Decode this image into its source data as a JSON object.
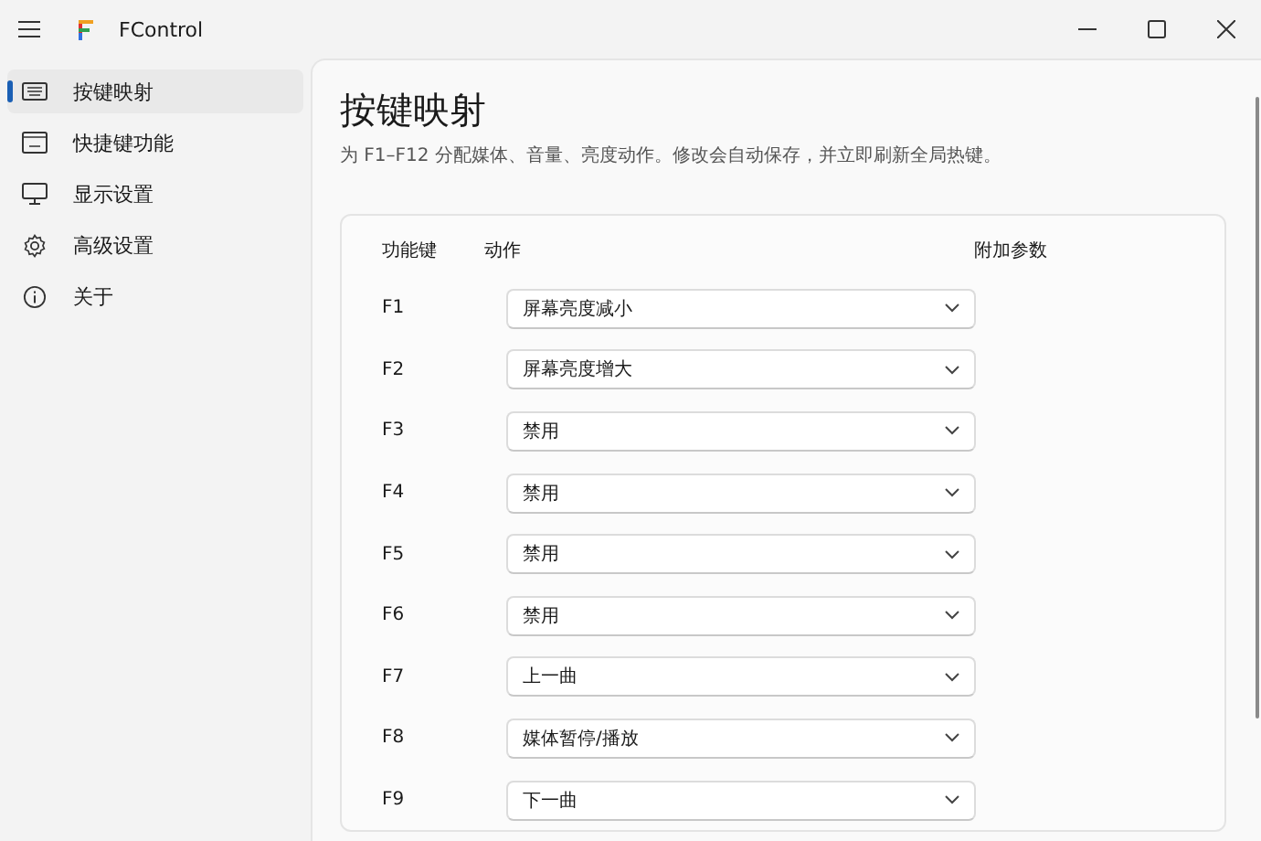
{
  "window": {
    "title": "FControl"
  },
  "sidebar": {
    "items": [
      {
        "label": "按键映射",
        "kind": "keyboard",
        "selected": true
      },
      {
        "label": "快捷键功能",
        "kind": "shortcut",
        "selected": false
      },
      {
        "label": "显示设置",
        "kind": "monitor",
        "selected": false
      },
      {
        "label": "高级设置",
        "kind": "gear",
        "selected": false
      },
      {
        "label": "关于",
        "kind": "info",
        "selected": false
      }
    ]
  },
  "page": {
    "title": "按键映射",
    "subtitle": "为 F1–F12 分配媒体、音量、亮度动作。修改会自动保存，并立即刷新全局热键。"
  },
  "table": {
    "columns": [
      "功能键",
      "动作",
      "附加参数"
    ],
    "rows": [
      {
        "key": "F1",
        "action": "屏幕亮度减小"
      },
      {
        "key": "F2",
        "action": "屏幕亮度增大"
      },
      {
        "key": "F3",
        "action": "禁用"
      },
      {
        "key": "F4",
        "action": "禁用"
      },
      {
        "key": "F5",
        "action": "禁用"
      },
      {
        "key": "F6",
        "action": "禁用"
      },
      {
        "key": "F7",
        "action": "上一曲"
      },
      {
        "key": "F8",
        "action": "媒体暂停/播放"
      },
      {
        "key": "F9",
        "action": "下一曲"
      }
    ]
  }
}
